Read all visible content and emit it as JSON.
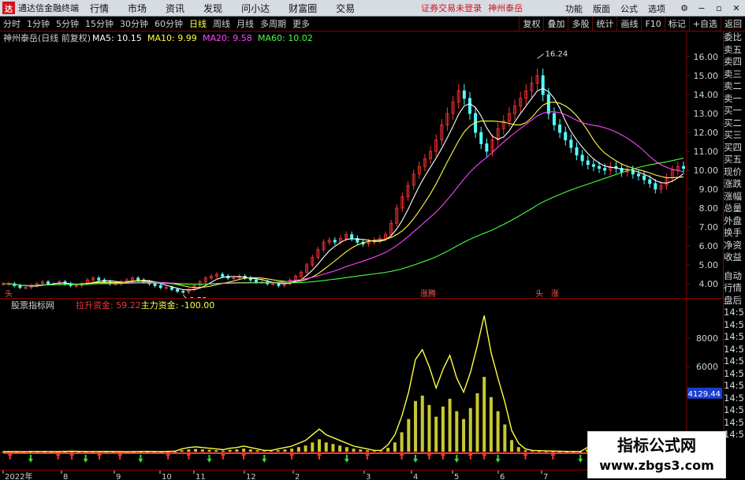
{
  "menubar": {
    "app_title": "通达信金融终端",
    "items": [
      "行情",
      "市场",
      "资讯",
      "发现",
      "问小达",
      "财富圈",
      "交易"
    ],
    "notice": "证券交易未登录",
    "stock_name": "神州泰岳",
    "right_items": [
      "功能",
      "版面",
      "公式",
      "选项"
    ],
    "window_buttons": {
      "settings": "⚙",
      "minimize": "−",
      "restore": "▫",
      "close": "✕"
    }
  },
  "toolbar": {
    "periods": [
      "分时",
      "1分钟",
      "5分钟",
      "15分钟",
      "30分钟",
      "60分钟",
      "日线",
      "周线",
      "月线",
      "多周期",
      "更多"
    ],
    "active_period": "日线",
    "right_tools": [
      "复权",
      "叠加",
      "多股",
      "统计",
      "画线",
      "F10",
      "标记",
      "+自选",
      "返回"
    ]
  },
  "main_chart": {
    "header_title": "神州泰岳(日线 前复权)",
    "ma_labels": [
      {
        "text": "MA5: 10.15",
        "color": "#ffffff"
      },
      {
        "text": "MA10: 9.99",
        "color": "#ffff44"
      },
      {
        "text": "MA20: 9.58",
        "color": "#ff44ff"
      },
      {
        "text": "MA60: 10.02",
        "color": "#44ff44"
      }
    ],
    "markers": [
      {
        "x": 6,
        "text": "头"
      },
      {
        "x": 533,
        "text": "涨腾"
      },
      {
        "x": 679,
        "text": "头"
      },
      {
        "x": 699,
        "text": "涨"
      }
    ]
  },
  "indicator_chart": {
    "header_title": "股票指标网",
    "labels": [
      {
        "text": "拉升资金: 59.22",
        "color": "#ff3333"
      },
      {
        "text": "主力资金: -100.00",
        "color": "#ffff44"
      }
    ],
    "highlight_value": "4129.44"
  },
  "chart_data": [
    {
      "type": "candlestick",
      "title": "神州泰岳(日线 前复权)",
      "ylim": [
        3.5,
        16.5
      ],
      "y_ticks": [
        16.0,
        15.0,
        14.0,
        13.0,
        12.0,
        11.0,
        10.0,
        9.0,
        8.0,
        7.0,
        6.0,
        5.0,
        4.0
      ],
      "annotations": [
        {
          "label": "16.24",
          "note": "period high"
        },
        {
          "label": "3.53",
          "note": "period low"
        }
      ],
      "x_ticks": [
        "2022年",
        "8",
        "9",
        "10",
        "11",
        "12",
        "2",
        "3",
        "4",
        "5",
        "6",
        "7"
      ],
      "close": [
        4.0,
        4.0,
        3.9,
        3.8,
        3.8,
        3.9,
        4.0,
        4.1,
        4.0,
        4.0,
        4.1,
        4.0,
        3.9,
        3.9,
        4.0,
        4.2,
        4.3,
        4.2,
        4.1,
        4.0,
        4.0,
        4.1,
        4.2,
        4.3,
        4.2,
        4.1,
        4.0,
        3.9,
        3.8,
        3.8,
        3.7,
        3.6,
        3.55,
        3.7,
        3.9,
        4.1,
        4.3,
        4.4,
        4.5,
        4.4,
        4.3,
        4.3,
        4.4,
        4.3,
        4.2,
        4.1,
        4.1,
        4.0,
        4.0,
        3.9,
        4.0,
        4.2,
        4.4,
        4.6,
        5.0,
        5.4,
        5.8,
        6.2,
        6.3,
        6.2,
        6.4,
        6.6,
        6.4,
        6.2,
        6.1,
        6.2,
        6.3,
        6.4,
        6.6,
        7.2,
        8.0,
        8.6,
        9.2,
        9.8,
        10.2,
        10.6,
        11.0,
        11.6,
        12.4,
        13.0,
        13.6,
        14.2,
        13.8,
        13.0,
        12.0,
        11.4,
        11.0,
        11.6,
        12.2,
        12.6,
        13.0,
        13.4,
        13.8,
        14.2,
        14.6,
        15.0,
        14.0,
        13.0,
        12.4,
        12.0,
        11.6,
        11.2,
        10.8,
        10.5,
        10.3,
        10.2,
        10.1,
        10.0,
        10.2,
        10.1,
        9.9,
        10.0,
        9.8,
        9.7,
        9.5,
        9.3,
        9.0,
        9.2,
        9.6,
        10.0,
        10.2,
        10.1
      ]
    },
    {
      "type": "line",
      "title": "股票指标网",
      "ylim": [
        -100,
        9900
      ],
      "y_ticks": [
        8000,
        6000,
        4000
      ],
      "series": [
        {
          "name": "拉升资金",
          "values": [
            10,
            15,
            10,
            5,
            20,
            25,
            20,
            15,
            10,
            30,
            40,
            30,
            20,
            15,
            25,
            30,
            20,
            10,
            5,
            10,
            20,
            30,
            20,
            10,
            30,
            40,
            200,
            300,
            350,
            300,
            250,
            200,
            150,
            250,
            300,
            400,
            300,
            200,
            100,
            100,
            200,
            300,
            400,
            600,
            800,
            1200,
            1600,
            1200,
            1000,
            800,
            600,
            400,
            300,
            200,
            100,
            100,
            500,
            1200,
            2500,
            4200,
            6500,
            7200,
            6000,
            4500,
            5800,
            6800,
            5200,
            4200,
            5600,
            7500,
            9600,
            7000,
            5200,
            3500,
            1500,
            600,
            200,
            100,
            80,
            60,
            50,
            40,
            30,
            20,
            20,
            300,
            800,
            600,
            500,
            700,
            400,
            200,
            150,
            100,
            80,
            60,
            50,
            40,
            30,
            20
          ]
        },
        {
          "name": "主力资金",
          "values": [
            -100,
            -100,
            -100,
            -100,
            -100,
            -100,
            -100,
            -100,
            -100,
            -100,
            -100,
            -100,
            -100,
            -100,
            -100,
            -100,
            -100,
            -100,
            -100,
            -100,
            -100,
            -100,
            -100,
            -100,
            -100,
            -100,
            -100,
            -100,
            -100,
            -100
          ]
        }
      ]
    }
  ],
  "right_panel": {
    "items": [
      "委比",
      "卖五",
      "卖四",
      "卖三",
      "卖二",
      "卖一",
      "买一",
      "买二",
      "买三",
      "买四",
      "买五",
      "现价",
      "涨跌",
      "涨幅",
      "总量",
      "外盘",
      "换手",
      "净资",
      "收益"
    ],
    "items2": [
      "自动",
      "行情",
      "盘后",
      "14:5",
      "14:5",
      "14:5",
      "14:5",
      "14:5",
      "14:5",
      "14:5",
      "14:5",
      "14:5",
      "14:5",
      "14:5"
    ]
  },
  "watermark": {
    "line1": "指标公式网",
    "line2": "www.zbgs3.com"
  },
  "colors": {
    "up": "#ff3333",
    "down": "#54ffff",
    "ma5": "#ffffff",
    "ma10": "#ffff44",
    "ma20": "#ff44ff",
    "ma60": "#44ff44",
    "grid": "#8b0000"
  }
}
